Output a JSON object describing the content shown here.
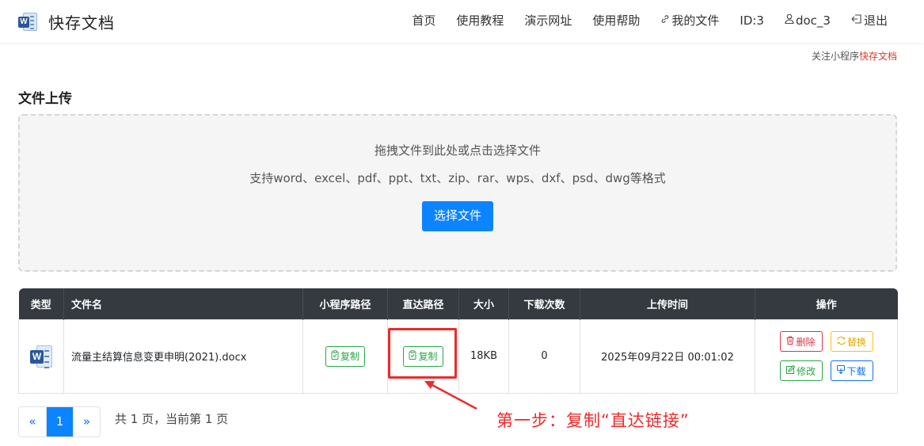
{
  "app": {
    "name": "快存文档",
    "logo_letter": "W"
  },
  "nav": {
    "home": "首页",
    "tutorial": "使用教程",
    "demo": "演示网址",
    "help": "使用帮助",
    "my_files": "我的文件",
    "my_files_icon": "link-icon",
    "user_id": "ID:3",
    "username": "doc_3",
    "username_icon": "user-icon",
    "logout": "退出",
    "logout_icon": "logout-icon"
  },
  "follow": {
    "prefix": "关注小程序",
    "link": "快存文档"
  },
  "upload": {
    "title": "文件上传",
    "hint": "拖拽文件到此处或点击选择文件",
    "formats": "支持word、excel、pdf、ppt、txt、zip、rar、wps、dxf、psd、dwg等格式",
    "button": "选择文件"
  },
  "table": {
    "headers": [
      "类型",
      "文件名",
      "小程序路径",
      "直达路径",
      "大小",
      "下载次数",
      "上传时间",
      "操作"
    ],
    "rows": [
      {
        "type_icon": "word-file-icon",
        "type_letter": "W",
        "filename": "流量主结算信息变更申明(2021).docx",
        "miniapp_copy": "复制",
        "direct_copy": "复制",
        "size": "18KB",
        "downloads": "0",
        "uploaded": "2025年09月22日 00:01:02",
        "actions": {
          "delete": "删除",
          "replace": "替换",
          "edit": "修改",
          "download": "下载"
        }
      }
    ]
  },
  "annotation": "第一步：复制“直达链接”",
  "pagination": {
    "prev": "«",
    "current": "1",
    "next": "»",
    "info": "共 1 页，当前第 1 页"
  },
  "colors": {
    "primary": "#0d84ff",
    "header_dark": "#343a40",
    "annotation_red": "#ee2a2a",
    "success": "#28a745",
    "danger": "#dc3545",
    "warning": "#ffc107",
    "info": "#0d6efd"
  }
}
